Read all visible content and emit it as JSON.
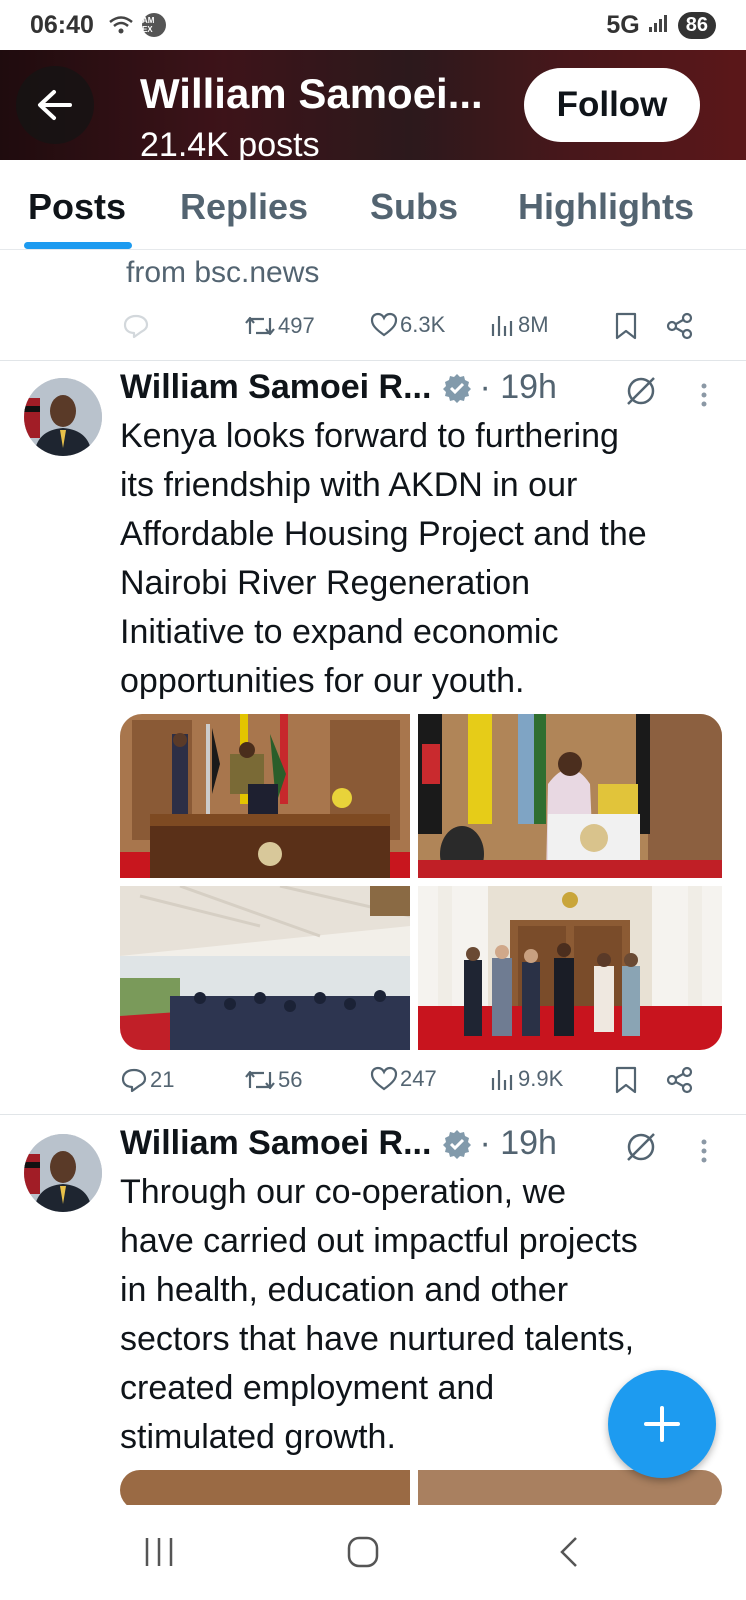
{
  "status_bar": {
    "time": "06:40",
    "network": "5G",
    "battery": "86",
    "notification_icons": [
      "wifi-question-icon",
      "amex-icon"
    ],
    "amex_text": "AM EX"
  },
  "header": {
    "title": "William Samoei...",
    "subtitle": "21.4K posts",
    "follow_label": "Follow"
  },
  "tabs": [
    {
      "label": "Posts",
      "active": true
    },
    {
      "label": "Replies",
      "active": false
    },
    {
      "label": "Subs",
      "active": false
    },
    {
      "label": "Highlights",
      "active": false
    }
  ],
  "partial_post": {
    "text": "from bsc.news",
    "reposts": "497",
    "likes": "6.3K",
    "views": "8M"
  },
  "posts": [
    {
      "author": "William Samoei R...",
      "time": "· 19h",
      "lines": [
        "Kenya looks forward to furthering",
        "its friendship with AKDN in our",
        "Affordable Housing Project and the",
        "Nairobi River Regeneration",
        "Initiative to expand economic",
        "opportunities for our youth."
      ],
      "replies": "21",
      "reposts": "56",
      "likes": "247",
      "views": "9.9K"
    },
    {
      "author": "William Samoei R...",
      "time": "· 19h",
      "lines": [
        "Through our co-operation, we",
        "have carried out impactful projects",
        "in health, education and other",
        "sectors that have nurtured talents,",
        "created employment and",
        "stimulated growth."
      ]
    }
  ],
  "colors": {
    "accent": "#1d9bf0",
    "text": "#0f1419",
    "muted": "#536471"
  }
}
